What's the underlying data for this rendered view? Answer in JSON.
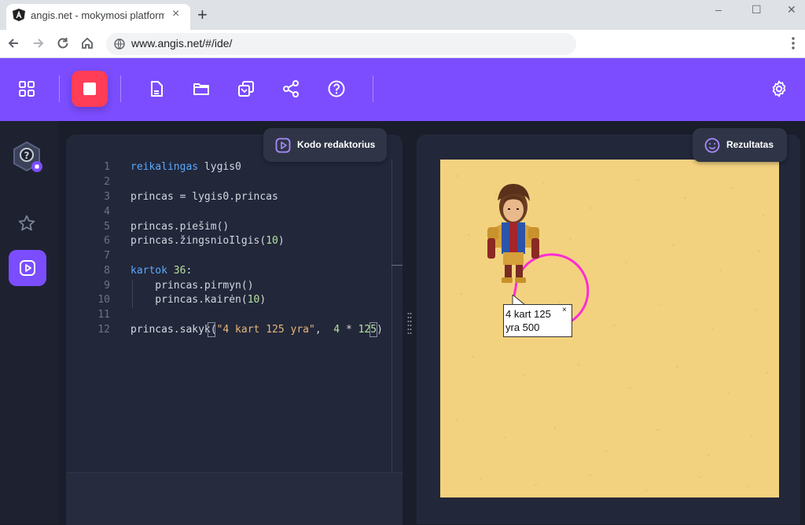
{
  "browser": {
    "tab_title": "angis.net - mokymosi platforma",
    "tab_close": "×",
    "new_tab": "+",
    "url": "www.angis.net/#/ide/",
    "window_controls": [
      "–",
      "☐",
      "✕"
    ]
  },
  "toolbar": {
    "icons": [
      "grid-icon",
      "stop-icon",
      "new-file-icon",
      "folder-icon",
      "copy-icon",
      "share-icon",
      "help-icon",
      "settings-icon"
    ],
    "accent": "#7b4dff",
    "stop_color": "#ff3d56"
  },
  "editor": {
    "tab_label": "Kodo redaktorius",
    "line_numbers": [
      "1",
      "2",
      "3",
      "4",
      "5",
      "6",
      "7",
      "8",
      "9",
      "10",
      "11",
      "12"
    ],
    "lines": [
      {
        "kw": "reikalingas",
        "rest": " lygis0"
      },
      {
        "text": ""
      },
      {
        "text": "princas = lygis0.princas"
      },
      {
        "text": ""
      },
      {
        "text": "princas.piešim()"
      },
      {
        "pre": "princas.žingsnioIlgis(",
        "num": "10",
        "post": ")"
      },
      {
        "text": ""
      },
      {
        "kw": "kartok",
        "num": "36",
        "post": ":"
      },
      {
        "text": "    princas.pirmyn()"
      },
      {
        "pre": "    princas.kairėn(",
        "num": "10",
        "post": ")"
      },
      {
        "text": ""
      },
      {
        "pre": "princas.sakyk(",
        "str": "\"4 kart 125 yra\"",
        "mid": ",  ",
        "num": "4",
        "mid2": " * ",
        "num2": "125",
        "post": ")"
      }
    ]
  },
  "result": {
    "tab_label": "Rezultatas",
    "bubble_line1": "4 kart 125",
    "bubble_line2": "yra 500",
    "bubble_close": "×"
  }
}
